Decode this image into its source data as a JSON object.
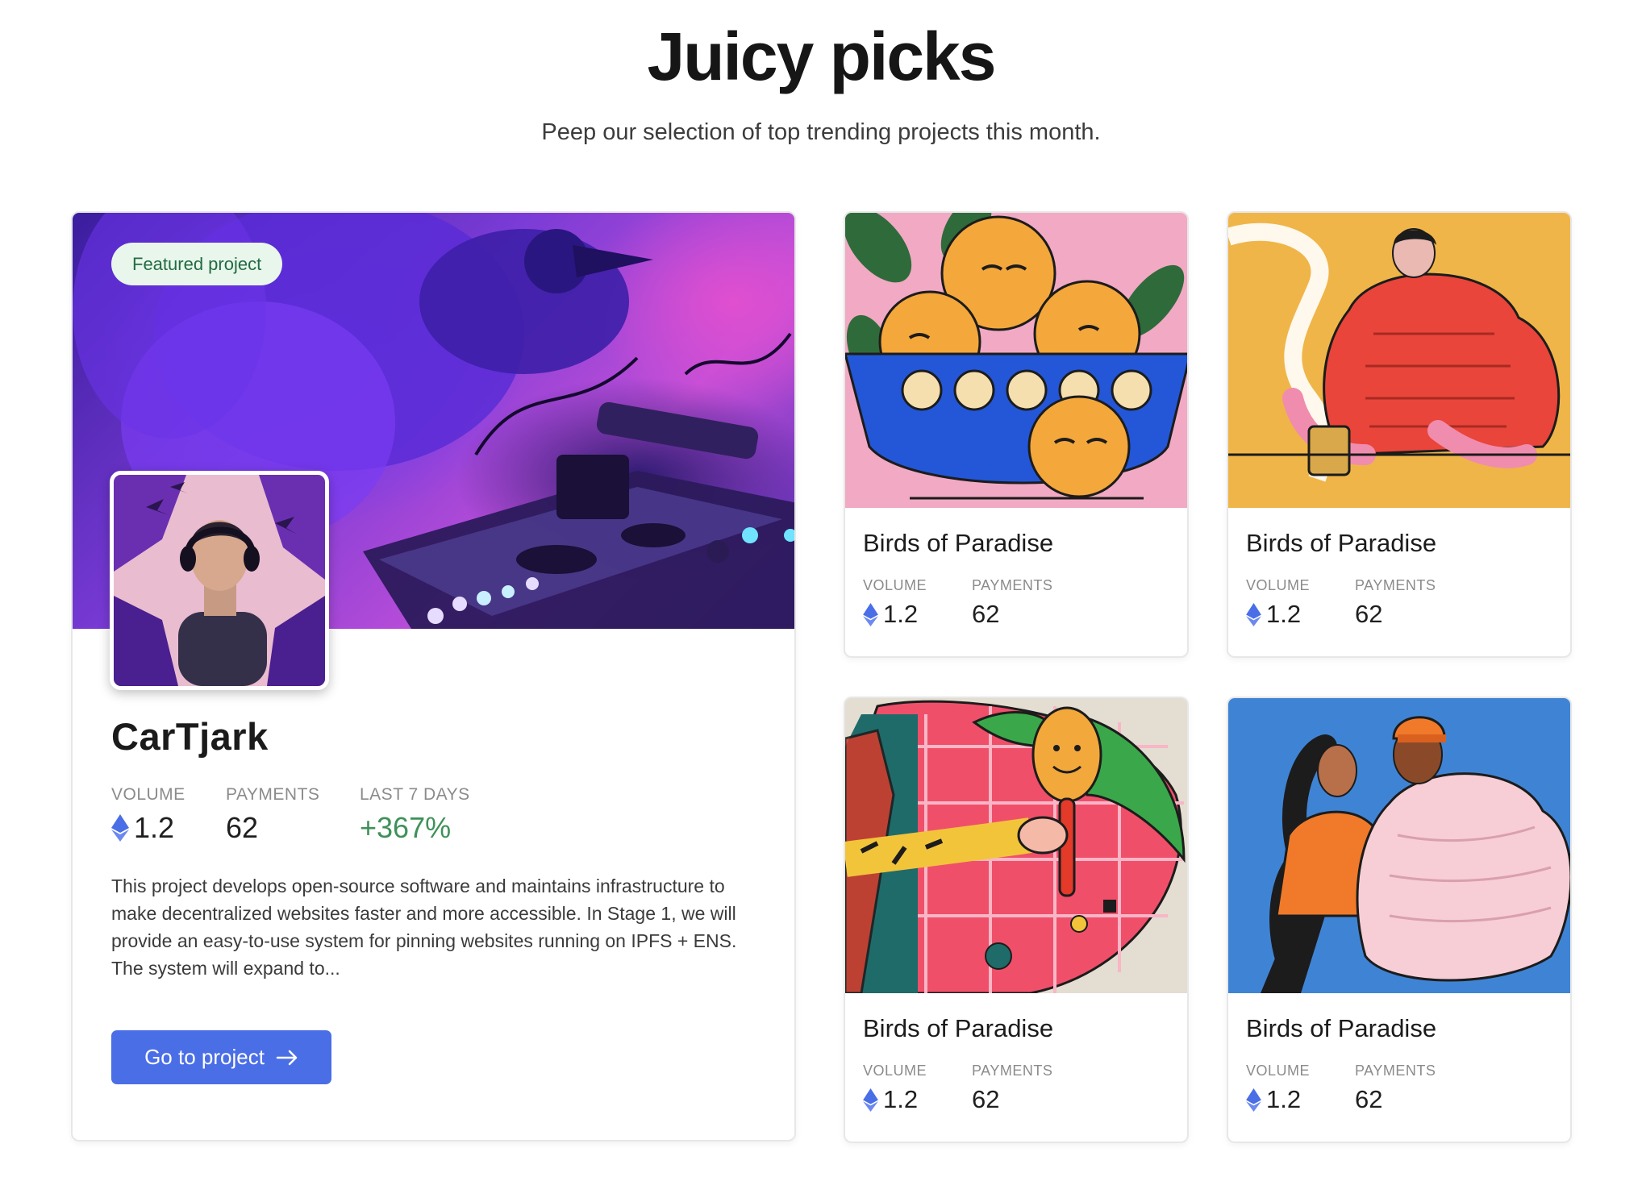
{
  "header": {
    "title": "Juicy picks",
    "subtitle": "Peep our selection of top trending projects this month."
  },
  "featured": {
    "badge": "Featured project",
    "name": "CarTjark",
    "stats": {
      "volume_label": "VOLUME",
      "volume_value": "1.2",
      "payments_label": "PAYMENTS",
      "payments_value": "62",
      "last7_label": "LAST 7 DAYS",
      "last7_value": "+367%"
    },
    "description": "This project develops open-source software and maintains infrastructure to make decentralized websites faster and more accessible. In Stage 1, we will provide an easy-to-use system for pinning websites running on IPFS + ENS. The system will expand to...",
    "cta_label": "Go to project",
    "cta_icon": "arrow-right-icon"
  },
  "cards": [
    {
      "title": "Birds of Paradise",
      "volume_label": "VOLUME",
      "volume_value": "1.2",
      "payments_label": "PAYMENTS",
      "payments_value": "62",
      "image": "lemons-in-blue-bowl"
    },
    {
      "title": "Birds of Paradise",
      "volume_label": "VOLUME",
      "volume_value": "1.2",
      "payments_label": "PAYMENTS",
      "payments_value": "62",
      "image": "person-in-red-puffer-jacket"
    },
    {
      "title": "Birds of Paradise",
      "volume_label": "VOLUME",
      "volume_value": "1.2",
      "payments_label": "PAYMENTS",
      "payments_value": "62",
      "image": "hand-holding-smiley-mirror"
    },
    {
      "title": "Birds of Paradise",
      "volume_label": "VOLUME",
      "volume_value": "1.2",
      "payments_label": "PAYMENTS",
      "payments_value": "62",
      "image": "couple-in-puffer-jackets"
    }
  ],
  "colors": {
    "accent": "#4a6ee6",
    "positive": "#3f9159",
    "badge_bg": "#e8f6ec",
    "eth": "#4a6ee6"
  }
}
